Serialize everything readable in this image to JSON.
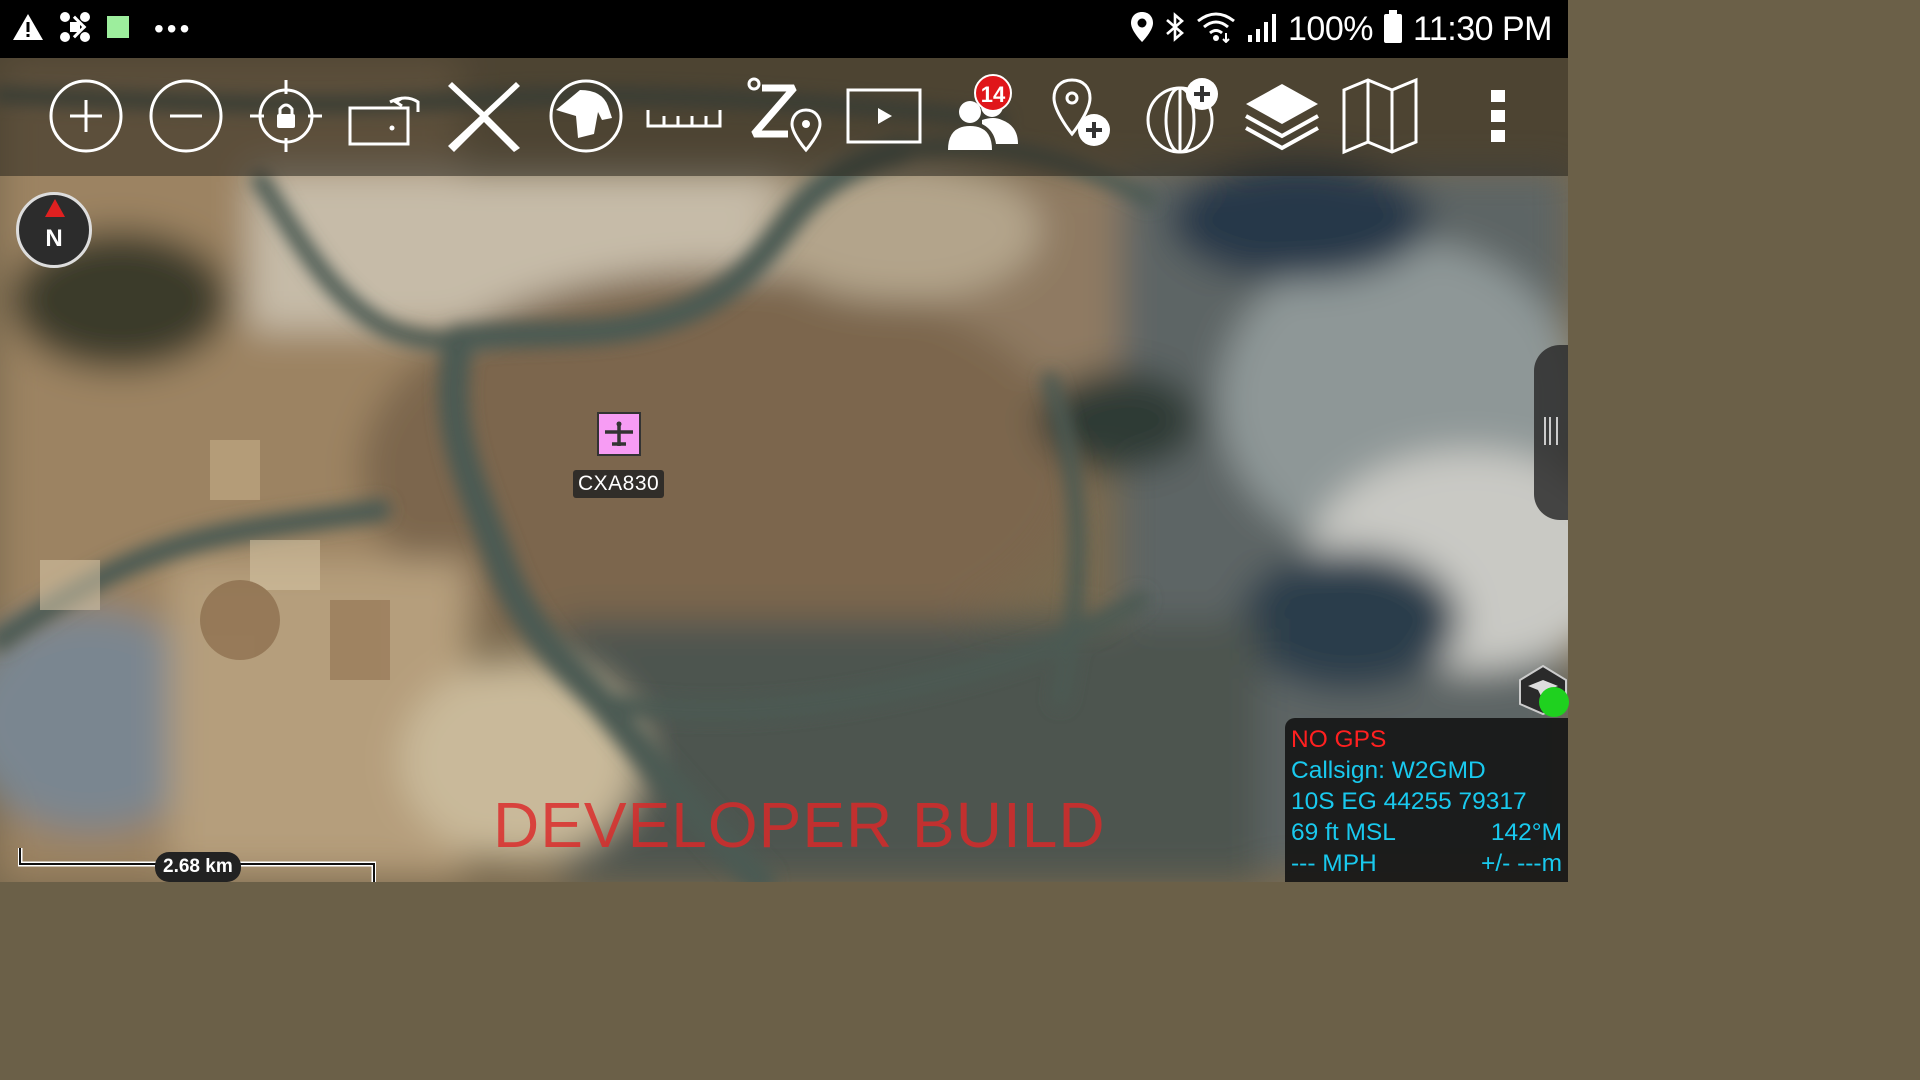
{
  "status_bar": {
    "left_icons": [
      "warning-icon",
      "drone-icon",
      "green-square-icon",
      "more-notifications-icon"
    ],
    "right_icons": [
      "location-icon",
      "bluetooth-icon",
      "wifi-icon",
      "signal-icon",
      "battery-icon"
    ],
    "battery": "100%",
    "time": "11:30 PM"
  },
  "toolbar": {
    "buttons": [
      "zoom-in",
      "zoom-out",
      "lock-on-self",
      "rotate-map",
      "tools",
      "bloodhound",
      "measure",
      "go-to-point",
      "video",
      "contacts",
      "add-point",
      "add-overlay",
      "layers",
      "maps",
      "overflow-menu"
    ],
    "contacts_badge": "14"
  },
  "compass": {
    "label": "N"
  },
  "track": {
    "callsign": "CXA830"
  },
  "watermark": "DEVELOPER BUILD",
  "scale": {
    "label": "2.68 km"
  },
  "self_info": {
    "gps": "NO GPS",
    "callsign": "Callsign: W2GMD",
    "mgrs": "10S  EG  44255  79317",
    "altitude": "69 ft MSL",
    "heading": "142°M",
    "speed": "--- MPH",
    "accuracy": "+/- ---m"
  },
  "colors": {
    "marker_fill": "#f79cf4",
    "badge": "#e0161a",
    "info_text": "#19c9ee",
    "gps_warning": "#ff2020",
    "watermark": "#dc2828"
  }
}
